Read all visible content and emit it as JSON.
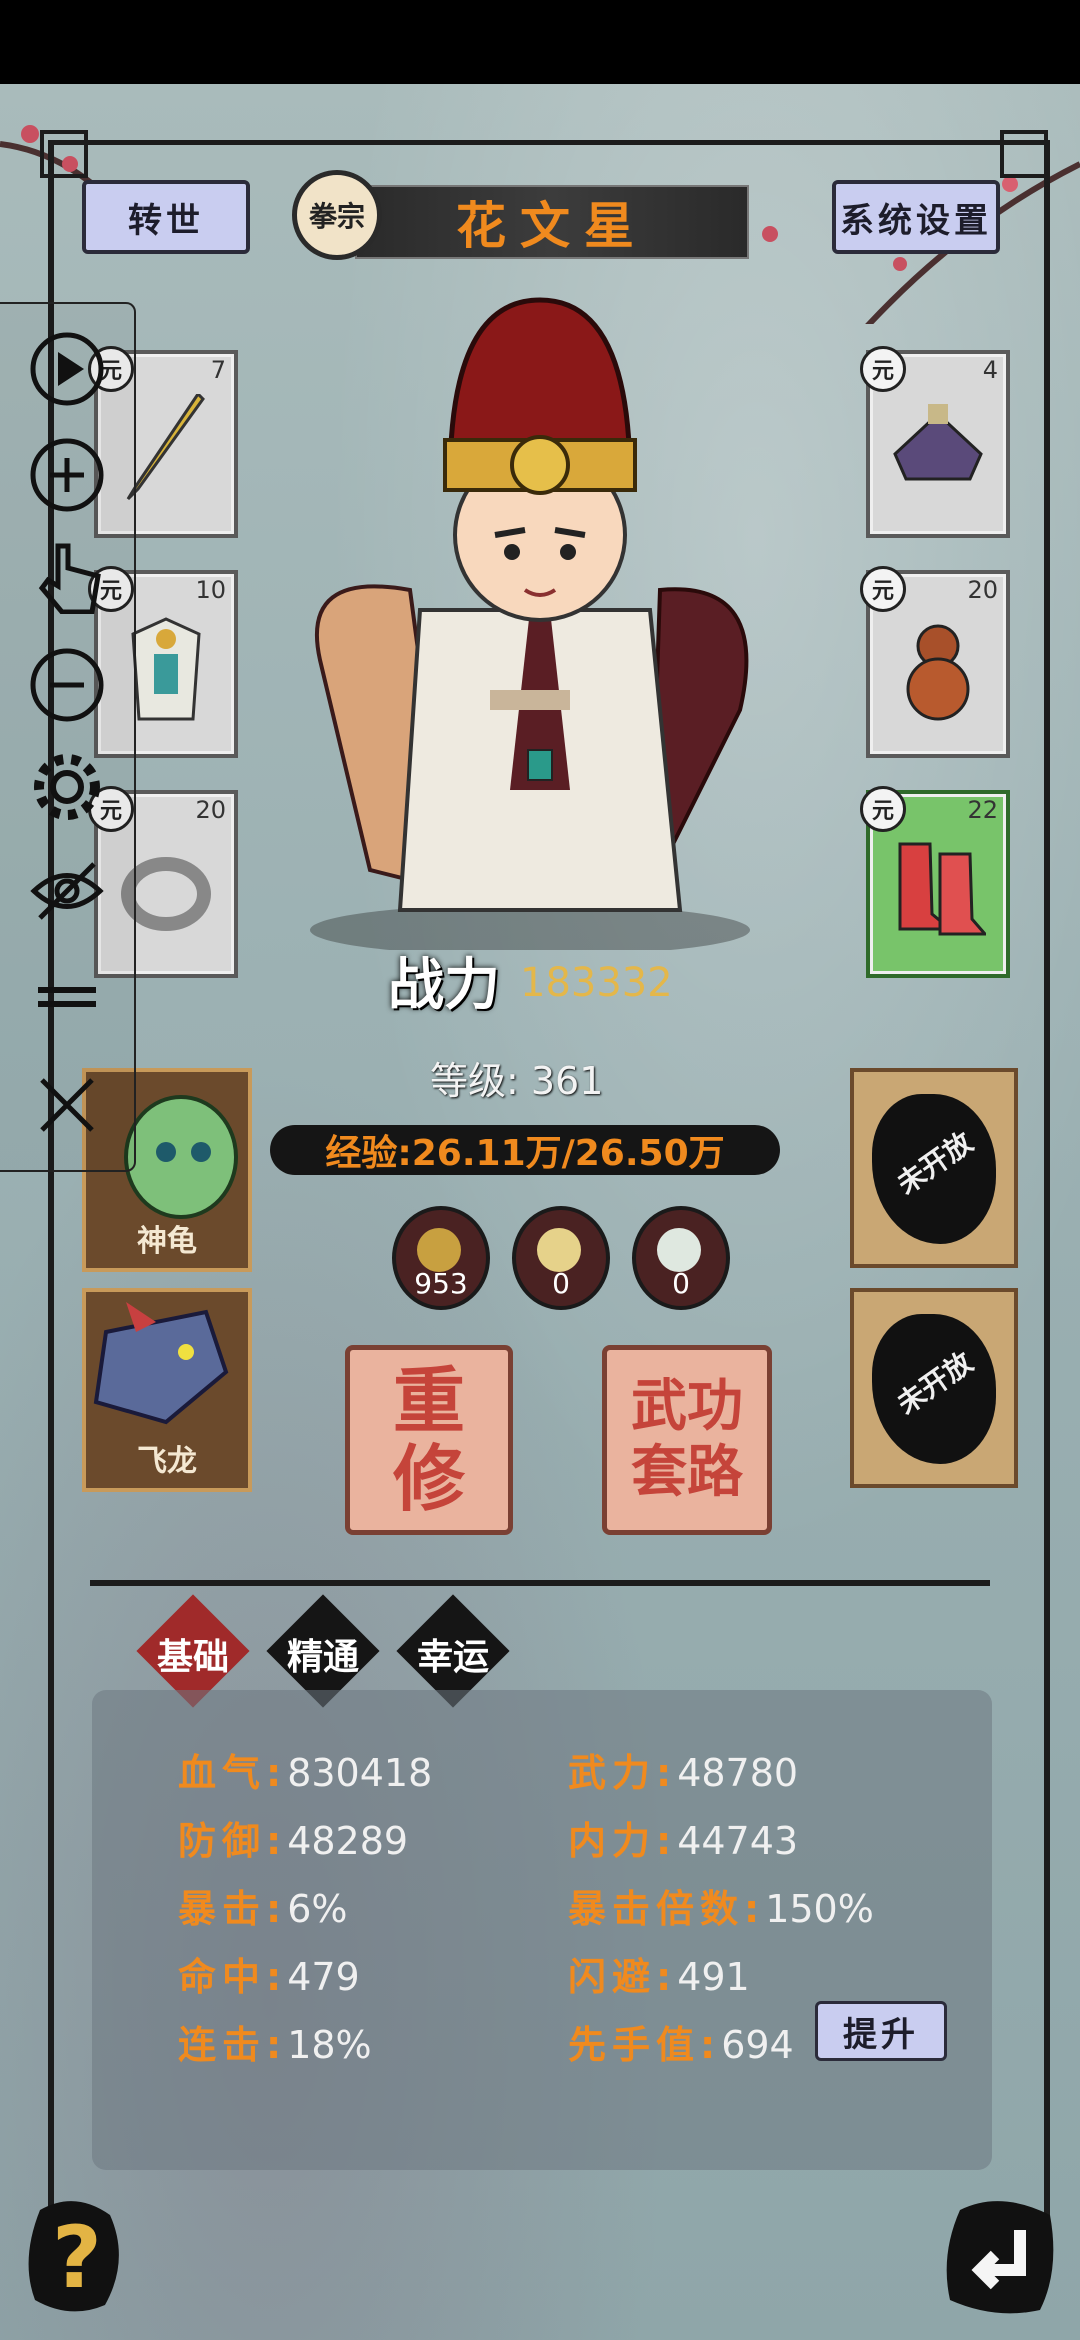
{
  "top": {
    "reincarnate_label": "转世",
    "school": "拳宗",
    "hero_name": "花文星",
    "settings_label": "系统设置"
  },
  "equipment_left": [
    {
      "level": "7",
      "grade": "元",
      "icon": "sword-icon"
    },
    {
      "level": "10",
      "grade": "元",
      "icon": "armor-icon"
    },
    {
      "level": "20",
      "grade": "元",
      "icon": "ring-icon"
    }
  ],
  "equipment_right": [
    {
      "level": "4",
      "grade": "元",
      "icon": "hat-icon"
    },
    {
      "level": "20",
      "grade": "元",
      "icon": "gourd-icon"
    },
    {
      "level": "22",
      "grade": "元",
      "icon": "boots-icon"
    }
  ],
  "power": {
    "label": "战力",
    "value": "183332"
  },
  "level_text": "等级: 361",
  "exp_text": "经验:26.11万/26.50万",
  "orbs": [
    "953",
    "0",
    "0"
  ],
  "pets": [
    {
      "label": "神龟"
    },
    {
      "label": "飞龙"
    }
  ],
  "locked_slots": [
    "未开放",
    "未开放"
  ],
  "actions": {
    "retrain": "重修",
    "martial_arts": "武功套路"
  },
  "tabs": [
    "基础",
    "精通",
    "幸运"
  ],
  "stats": {
    "hp_label": "血气:",
    "hp": "830418",
    "atk_label": "武力:",
    "atk": "48780",
    "def_label": "防御:",
    "def": "48289",
    "inner_label": "内力:",
    "inner": "44743",
    "crit_label": "暴击:",
    "crit": "6%",
    "critmult_label": "暴击倍数:",
    "critmult": "150%",
    "hit_label": "命中:",
    "hit": "479",
    "dodge_label": "闪避:",
    "dodge": "491",
    "combo_label": "连击:",
    "combo": "18%",
    "initiative_label": "先手值:",
    "initiative": "694"
  },
  "upgrade_label": "提升",
  "help_label": "?"
}
